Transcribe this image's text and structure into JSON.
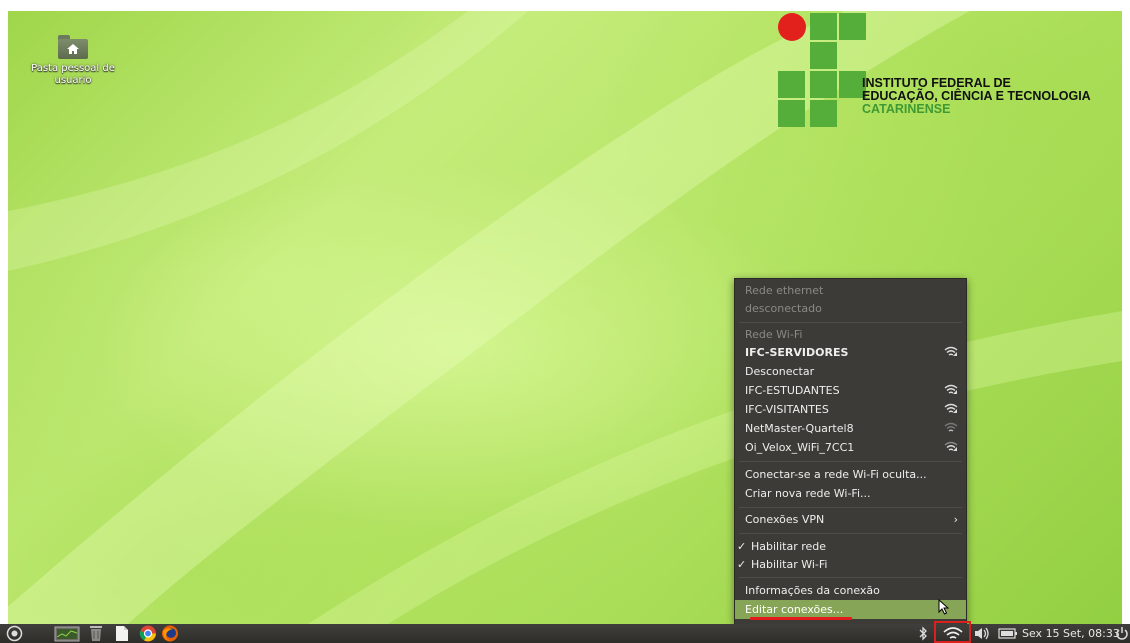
{
  "desktop": {
    "folder_label_line1": "Pasta pessoal de",
    "folder_label_line2": "usuario"
  },
  "logo": {
    "line1": "INSTITUTO FEDERAL DE",
    "line2": "EDUCAÇÃO, CIÊNCIA E TECNOLOGIA",
    "line3": "CATARINENSE"
  },
  "network_menu": {
    "ethernet_header": "Rede ethernet",
    "ethernet_status": "desconectado",
    "wifi_header": "Rede Wi-Fi",
    "networks": [
      {
        "name": "IFC-SERVIDORES",
        "connected": true,
        "signal": "strong"
      },
      {
        "name": "Desconectar"
      },
      {
        "name": "IFC-ESTUDANTES",
        "signal": "strong"
      },
      {
        "name": "IFC-VISITANTES",
        "signal": "strong"
      },
      {
        "name": "NetMaster-Quartel8",
        "signal": "weak"
      },
      {
        "name": "Oi_Velox_WiFi_7CC1",
        "signal": "medium"
      }
    ],
    "hidden_network": "Conectar-se a rede Wi-Fi oculta...",
    "new_network": "Criar nova rede Wi-Fi...",
    "vpn": "Conexões VPN",
    "enable_network": "Habilitar rede",
    "enable_wifi": "Habilitar Wi-Fi",
    "info": "Informações da conexão",
    "edit": "Editar conexões..."
  },
  "panel": {
    "clock": "Sex 15 Set, 08:33",
    "icons": [
      "dash-icon",
      "system-monitor-icon",
      "trash-icon",
      "files-icon",
      "chrome-icon",
      "firefox-icon",
      "bluetooth-icon",
      "wifi-icon",
      "volume-icon",
      "battery-icon",
      "power-icon"
    ]
  },
  "colors": {
    "highlight": "#87a556",
    "annotation_red": "#e31b1b",
    "menu_bg": "#3c3b37"
  }
}
